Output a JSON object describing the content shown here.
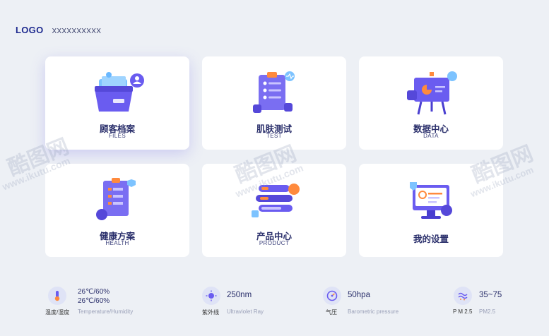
{
  "header": {
    "logo": "LOGO",
    "subtitle": "XXXXXXXXXX"
  },
  "cards": [
    {
      "label": "顾客档案",
      "sub": "FILES"
    },
    {
      "label": "肌肤测试",
      "sub": "TEST"
    },
    {
      "label": "数据中心",
      "sub": "DATA"
    },
    {
      "label": "健康方案",
      "sub": "HEALTH"
    },
    {
      "label": "产品中心",
      "sub": "PRODUCT"
    },
    {
      "label": "我的设置",
      "sub": ""
    }
  ],
  "status": {
    "temp_humidity": {
      "value1": "26℃/60%",
      "value2": "26℃/60%",
      "caption": "温度/湿度",
      "en": "Temperature/Humidity",
      "icon": "thermometer-icon"
    },
    "uv": {
      "value": "250nm",
      "caption": "紫外线",
      "en": "Ultraviolet Ray",
      "icon": "uv-sun-icon"
    },
    "pressure": {
      "value": "50hpa",
      "caption": "气压",
      "en": "Barometric pressure",
      "icon": "gauge-icon"
    },
    "pm25": {
      "value": "35~75",
      "caption": "P M 2.5",
      "en": "PM2.5",
      "icon": "pm25-icon"
    }
  },
  "watermark": {
    "brand": "酷图网",
    "url": "www.ikutu.com"
  },
  "colors": {
    "accent": "#6a5cf0",
    "orange": "#ff8a3d",
    "background": "#edf0f5"
  }
}
